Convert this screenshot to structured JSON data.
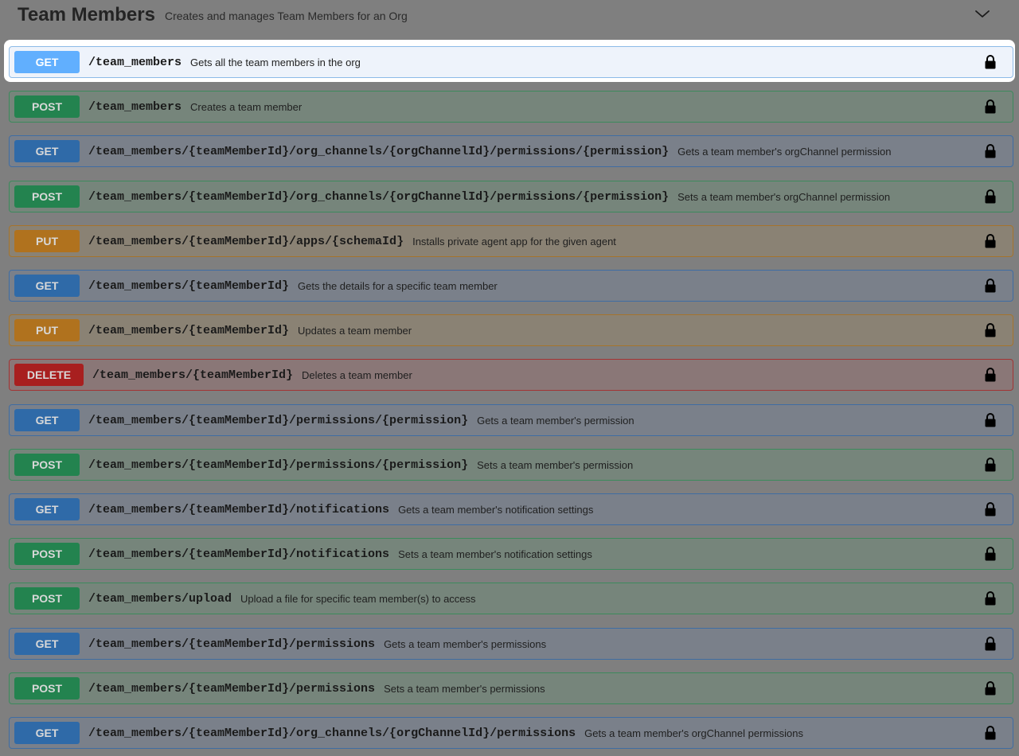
{
  "section": {
    "title": "Team Members",
    "description": "Creates and manages Team Members for an Org",
    "collapse_icon": "chevron-down-icon"
  },
  "operations": [
    {
      "method": "GET",
      "path": "/team_members",
      "summary": "Gets all the team members in the org",
      "highlighted": true
    },
    {
      "method": "POST",
      "path": "/team_members",
      "summary": "Creates a team member"
    },
    {
      "method": "GET",
      "path": "/team_members/{teamMemberId}/org_channels/{orgChannelId}/permissions/{permission}",
      "summary": "Gets a team member's orgChannel permission"
    },
    {
      "method": "POST",
      "path": "/team_members/{teamMemberId}/org_channels/{orgChannelId}/permissions/{permission}",
      "summary": "Sets a team member's orgChannel permission"
    },
    {
      "method": "PUT",
      "path": "/team_members/{teamMemberId}/apps/{schemaId}",
      "summary": "Installs private agent app for the given agent"
    },
    {
      "method": "GET",
      "path": "/team_members/{teamMemberId}",
      "summary": "Gets the details for a specific team member"
    },
    {
      "method": "PUT",
      "path": "/team_members/{teamMemberId}",
      "summary": "Updates a team member"
    },
    {
      "method": "DELETE",
      "path": "/team_members/{teamMemberId}",
      "summary": "Deletes a team member"
    },
    {
      "method": "GET",
      "path": "/team_members/{teamMemberId}/permissions/{permission}",
      "summary": "Gets a team member's permission"
    },
    {
      "method": "POST",
      "path": "/team_members/{teamMemberId}/permissions/{permission}",
      "summary": "Sets a team member's permission"
    },
    {
      "method": "GET",
      "path": "/team_members/{teamMemberId}/notifications",
      "summary": "Gets a team member's notification settings"
    },
    {
      "method": "POST",
      "path": "/team_members/{teamMemberId}/notifications",
      "summary": "Sets a team member's notification settings"
    },
    {
      "method": "POST",
      "path": "/team_members/upload",
      "summary": "Upload a file for specific team member(s) to access"
    },
    {
      "method": "GET",
      "path": "/team_members/{teamMemberId}/permissions",
      "summary": "Gets a team member's permissions"
    },
    {
      "method": "POST",
      "path": "/team_members/{teamMemberId}/permissions",
      "summary": "Sets a team member's permissions"
    },
    {
      "method": "GET",
      "path": "/team_members/{teamMemberId}/org_channels/{orgChannelId}/permissions",
      "summary": "Gets a team member's orgChannel permissions"
    }
  ],
  "lock_icon": "lock-icon",
  "colors": {
    "get": "#61affe",
    "post": "#49cc90",
    "put": "#fca130",
    "delete": "#f93e3e",
    "overlay": "#7f7f7f"
  }
}
